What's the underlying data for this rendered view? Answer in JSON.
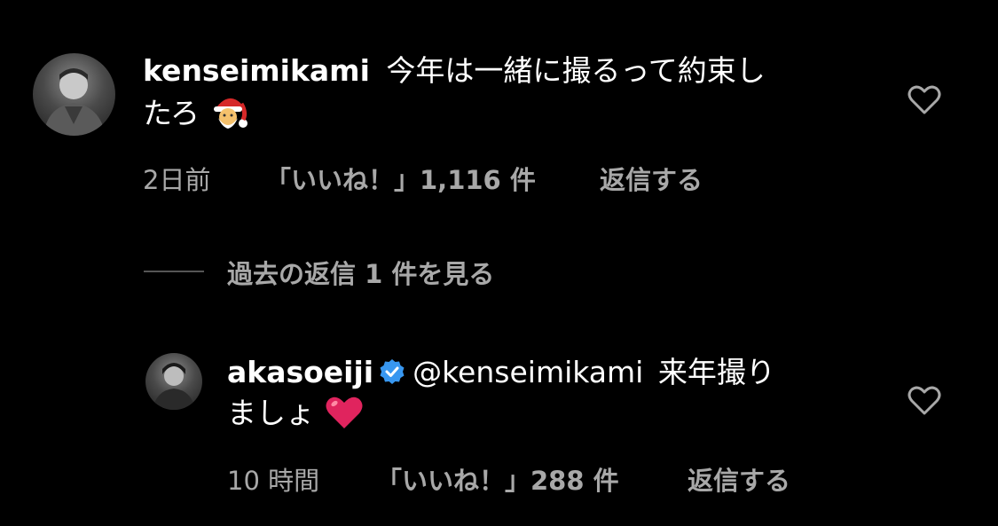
{
  "comments": [
    {
      "username": "kenseimikami",
      "text_line1": "今年は一緒に撮るって約束し",
      "text_line2": "たろ",
      "emoji_icon": "santa-emoji",
      "time": "2日前",
      "likes": "「いいね！」1,116 件",
      "reply": "返信する",
      "like_icon": "heart-outline-icon"
    },
    {
      "username": "akasoeiji",
      "verified_icon": "verified-badge-icon",
      "mention": "@kenseimikami",
      "text_line1": "来年撮り",
      "text_line2": "ましょ",
      "emoji_icon": "red-heart-emoji",
      "time": "10 時間",
      "likes": "「いいね！」288 件",
      "reply": "返信する",
      "like_icon": "heart-outline-icon"
    }
  ],
  "view_replies": "過去の返信 1 件を見る",
  "colors": {
    "background": "#000000",
    "text": "#ffffff",
    "secondary": "#a8a8a8",
    "verified": "#3897f0",
    "heart_emoji": "#e0245e"
  }
}
